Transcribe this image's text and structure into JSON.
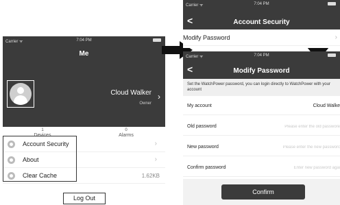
{
  "me_screen": {
    "status_bar": {
      "carrier": "Carrier ᯤ",
      "time": "7:04 PM"
    },
    "title": "Me",
    "user": {
      "name": "Cloud Walker",
      "role": "Owner"
    },
    "stats": [
      {
        "count": "1",
        "label": "Devices"
      },
      {
        "count": "0",
        "label": "Alarms"
      }
    ],
    "menu": [
      {
        "label": "Account Security",
        "icon": "shield-icon"
      },
      {
        "label": "About",
        "icon": "info-icon"
      },
      {
        "label": "Clear Cache",
        "icon": "trash-icon",
        "value": "1.62KB"
      }
    ],
    "logout_label": "Log Out"
  },
  "account_security_screen": {
    "status_bar": {
      "carrier": "Carrier ᯤ",
      "time": "7:04 PM"
    },
    "back_icon": "<",
    "title": "Account Security",
    "row_label": "Modify Password"
  },
  "modify_password_screen": {
    "status_bar": {
      "carrier": "Carrier ᯤ",
      "time": "7:04 PM"
    },
    "back_icon": "<",
    "title": "Modify Password",
    "hint": "Set the WatchPower password, you can login directly to WatchPower with your account",
    "fields": {
      "account": {
        "label": "My account",
        "value": "Cloud Walke"
      },
      "old_password": {
        "label": "Old password",
        "placeholder": "Please enter the old passwore"
      },
      "new_password": {
        "label": "New password",
        "placeholder": "Please enter the new passworc"
      },
      "confirm_password": {
        "label": "Confirm password",
        "placeholder": "Enter new password agai"
      }
    },
    "confirm_label": "Confirm"
  },
  "colors": {
    "header": "#3b3b3b",
    "arrow": "#111111"
  }
}
